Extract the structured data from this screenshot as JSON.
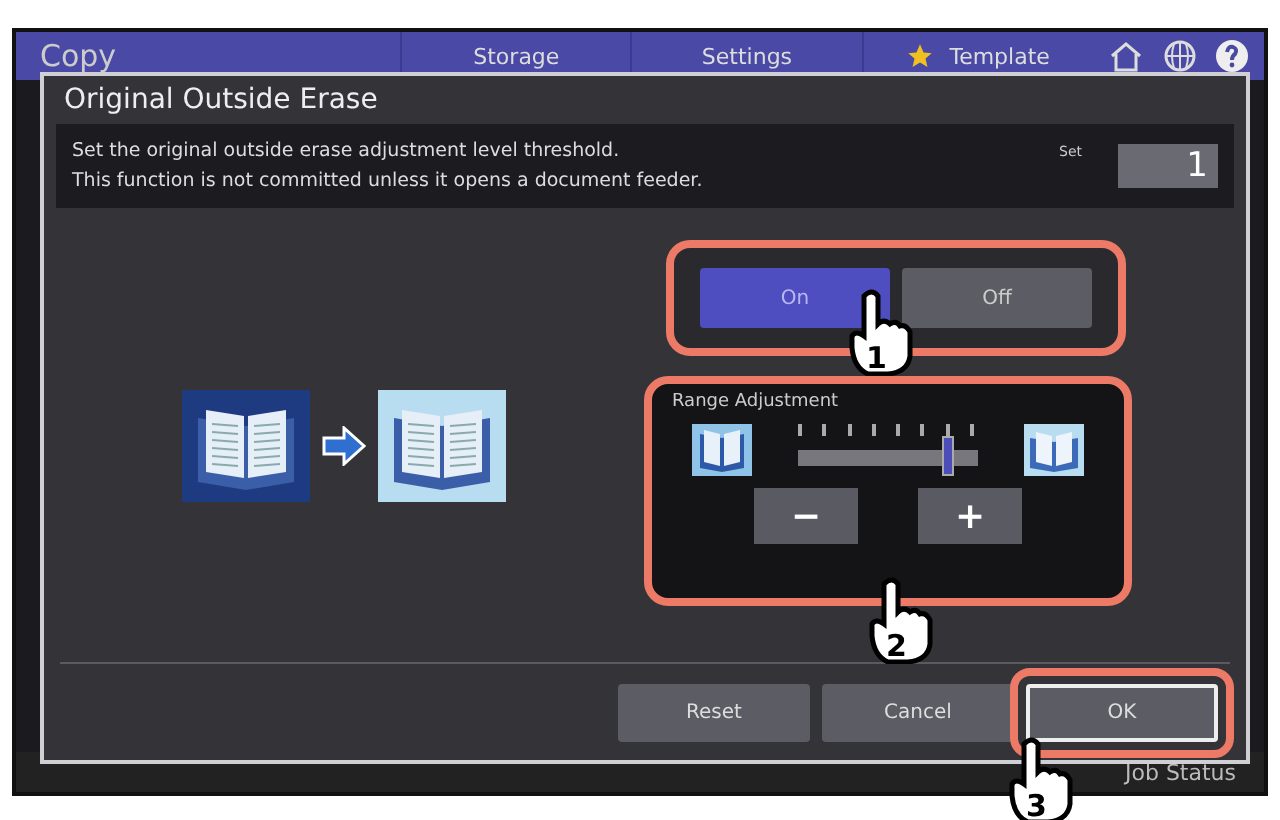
{
  "nav": {
    "app": "Copy",
    "tabs": [
      {
        "label": "Storage",
        "starred": false
      },
      {
        "label": "Settings",
        "starred": false
      },
      {
        "label": "Template",
        "starred": true
      }
    ]
  },
  "dialog": {
    "title": "Original Outside Erase",
    "message": [
      "Set the original outside erase adjustment level threshold.",
      "This function is not committed unless it opens a document feeder."
    ],
    "set_label": "Set",
    "set_value": "1",
    "toggle": [
      {
        "label": "On",
        "selected": true
      },
      {
        "label": "Off",
        "selected": false
      }
    ],
    "range": {
      "label": "Range Adjustment",
      "level": 0.86,
      "minus": "−",
      "plus": "+"
    },
    "buttons": [
      {
        "label": "Reset",
        "primary": false
      },
      {
        "label": "Cancel",
        "primary": false
      },
      {
        "label": "OK",
        "primary": true
      }
    ]
  },
  "status": {
    "job_status": "Job Status"
  },
  "callouts": [
    {
      "number": "1"
    },
    {
      "number": "2"
    },
    {
      "number": "3"
    }
  ]
}
